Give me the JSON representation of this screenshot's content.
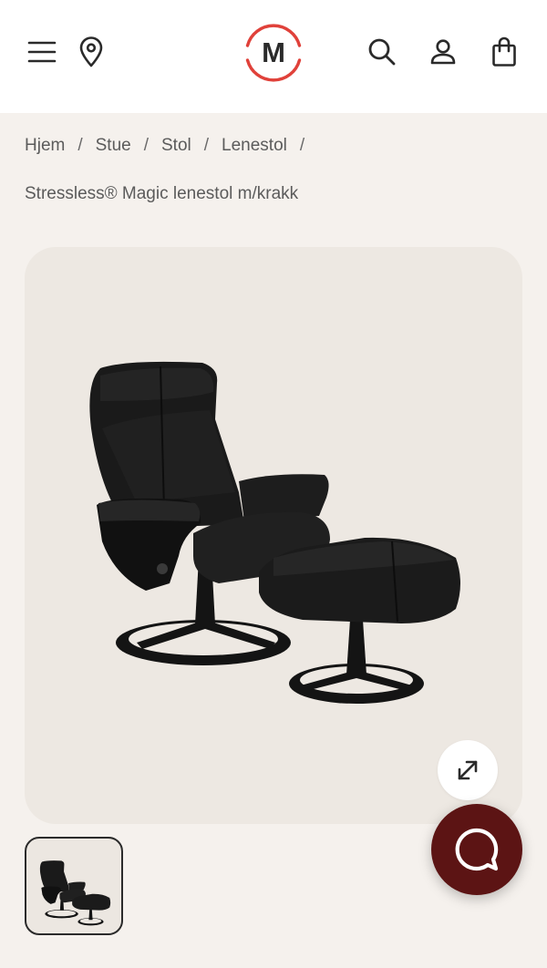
{
  "header": {
    "logo_letter": "M",
    "icons": [
      "menu-icon",
      "location-pin-icon",
      "search-icon",
      "user-icon",
      "shopping-bag-icon"
    ]
  },
  "breadcrumb": {
    "items": [
      "Hjem",
      "Stue",
      "Stol",
      "Lenestol"
    ],
    "separator": "/"
  },
  "product": {
    "title": "Stressless® Magic lenestol m/krakk"
  },
  "colors": {
    "brand_red": "#e0413a",
    "chat_button": "#5c1414",
    "page_bg": "#f5f1ed",
    "gallery_bg": "#ede8e2"
  }
}
